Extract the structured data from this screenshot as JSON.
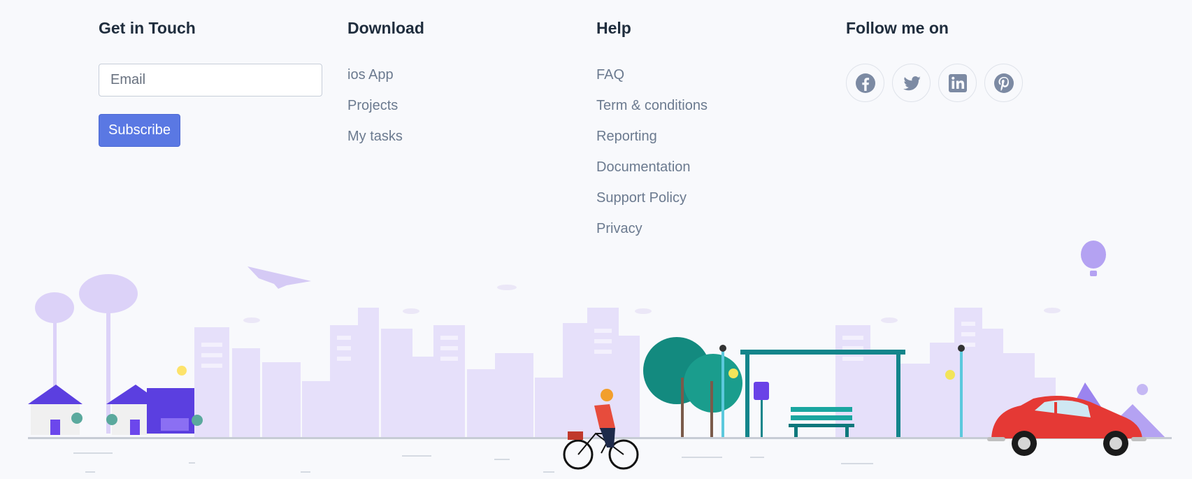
{
  "get_in_touch": {
    "title": "Get in Touch",
    "email_placeholder": "Email",
    "subscribe_label": "Subscribe"
  },
  "download": {
    "title": "Download",
    "links": [
      "ios App",
      "Projects",
      "My tasks"
    ]
  },
  "help": {
    "title": "Help",
    "links": [
      "FAQ",
      "Term & conditions",
      "Reporting",
      "Documentation",
      "Support Policy",
      "Privacy"
    ]
  },
  "follow": {
    "title": "Follow me on",
    "icons": [
      "facebook-icon",
      "twitter-icon",
      "linkedin-icon",
      "pinterest-icon"
    ]
  },
  "colors": {
    "accent": "#5a78e3",
    "link": "#6b7a8f",
    "heading": "#1f2d3d",
    "skyline": "#e6e0fa",
    "car": "#e53935",
    "teal": "#13858b"
  }
}
